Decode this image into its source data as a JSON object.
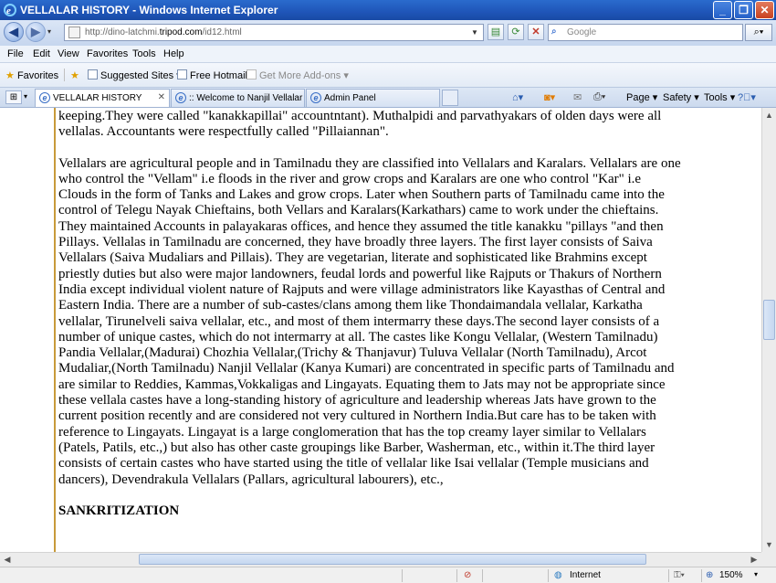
{
  "window": {
    "title": "VELLALAR HISTORY - Windows Internet Explorer",
    "minimize_glyph": "_",
    "maximize_glyph": "❐",
    "close_glyph": "✕"
  },
  "address_bar": {
    "url_prefix": "http://dino-latchmi.",
    "url_domain": "tripod.com",
    "url_suffix": "/id12.html",
    "search_placeholder": "Google"
  },
  "menu": [
    "File",
    "Edit",
    "View",
    "Favorites",
    "Tools",
    "Help"
  ],
  "favorites_bar": {
    "favorites_label": "Favorites",
    "items": [
      "Suggested Sites ▾",
      "Free Hotmail",
      "Get More Add-ons ▾"
    ]
  },
  "tabs": [
    {
      "label": "VELLALAR HISTORY",
      "active": true
    },
    {
      "label": ":: Welcome to Nanjil Vellalar ...",
      "active": false
    },
    {
      "label": "Admin Panel",
      "active": false
    }
  ],
  "command_bar": {
    "page": "Page ▾",
    "safety": "Safety ▾",
    "tools": "Tools ▾"
  },
  "content": {
    "para1": "keeping.They were called \"kanakkapillai\" accountntant). Muthalpidi and parvathyakars of olden days were all vellalas. Accountants were respectfully called \"Pillaiannan\".",
    "para2": "Vellalars are agricultural people and in Tamilnadu they are classified into Vellalars and Karalars. Vellalars are one who control the \"Vellam\" i.e floods in the river and grow crops and Karalars are one who control \"Kar\" i.e Clouds in the form of Tanks and Lakes and grow crops. Later when Southern parts of Tamilnadu came into the control of Telegu Nayak Chieftains, both Vellars and Karalars(Karkathars) came to work under the chieftains. They maintained Accounts in palayakaras offices, and hence they assumed the title kanakku \"pillays \"and then Pillays. Vellalas in Tamilnadu are concerned, they have broadly three layers. The first layer consists of Saiva Vellalars (Saiva Mudaliars and Pillais). They are vegetarian, literate and sophisticated like Brahmins except priestly duties but also were major landowners, feudal lords and powerful like Rajputs or Thakurs of Northern India except individual violent nature of Rajputs and were village administrators like Kayasthas of Central and Eastern India. There are a number of sub-castes/clans among them like Thondaimandala vellalar, Karkatha vellalar, Tirunelveli saiva vellalar, etc., and most of them intermarry these days.The second layer consists of a number of unique castes, which do not intermarry at all. The castes like Kongu Vellalar, (Western Tamilnadu) Pandia Vellalar,(Madurai) Chozhia Vellalar,(Trichy & Thanjavur) Tuluva Vellalar (North Tamilnadu), Arcot Mudaliar,(North Tamilnadu) Nanjil Vellalar (Kanya Kumari) are concentrated in specific parts of Tamilnadu and are similar to Reddies, Kammas,Vokkaligas and Lingayats. Equating them to Jats may not be appropriate since these vellala castes have a long-standing history of agriculture and leadership whereas Jats have grown to the current position recently and are considered not very cultured in Northern India.But care has to be taken with reference to Lingayats. Lingayat is a large conglomeration that has the top creamy layer similar to Vellalars (Patels, Patils, etc.,) but also has other caste groupings like Barber, Washerman, etc., within it.The third layer consists of certain castes who have started using the title of vellalar like Isai vellalar (Temple musicians and dancers), Devendrakula Vellalars (Pallars, agricultural labourers), etc.,",
    "heading": "SANKRITIZATION"
  },
  "status_bar": {
    "zone": "Internet",
    "zoom": "150%"
  }
}
